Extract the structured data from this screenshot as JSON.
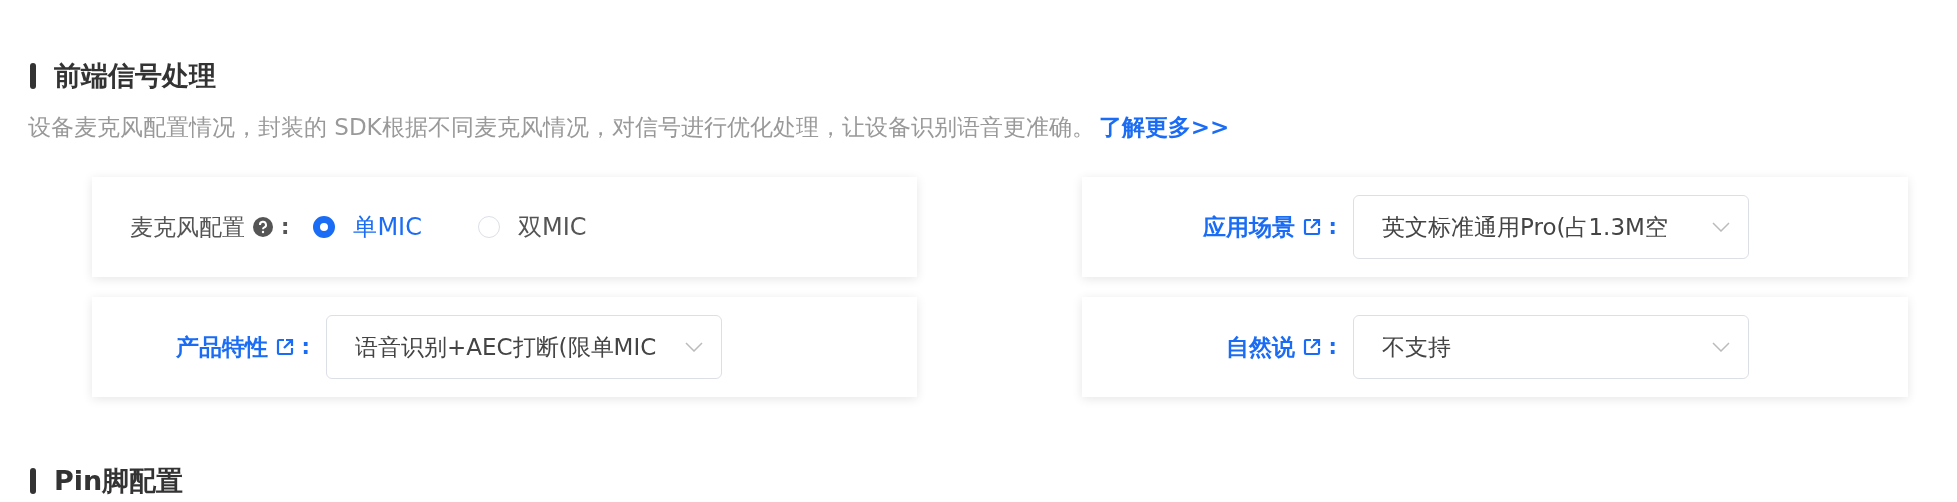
{
  "section": {
    "title": "前端信号处理",
    "description": "设备麦克风配置情况，封装的 SDK根据不同麦克风情况，对信号进行优化处理，让设备识别语音更准确。",
    "link": "了解更多>>"
  },
  "fields": [
    {
      "kind": "radio",
      "label": "麦克风配置",
      "colon": ":",
      "options": [
        {
          "label": "单MIC",
          "selected": true
        },
        {
          "label": "双MIC",
          "selected": false
        }
      ]
    },
    {
      "kind": "select",
      "label": "应用场景",
      "colon": ":",
      "value": "英文标准通用Pro(占1.3M空"
    },
    {
      "kind": "select",
      "label": "产品特性",
      "colon": ":",
      "value": "语音识别+AEC打断(限单MIC"
    },
    {
      "kind": "select",
      "label": "自然说",
      "colon": ":",
      "value": "不支持"
    }
  ],
  "next_section": {
    "title": "Pin脚配置"
  }
}
